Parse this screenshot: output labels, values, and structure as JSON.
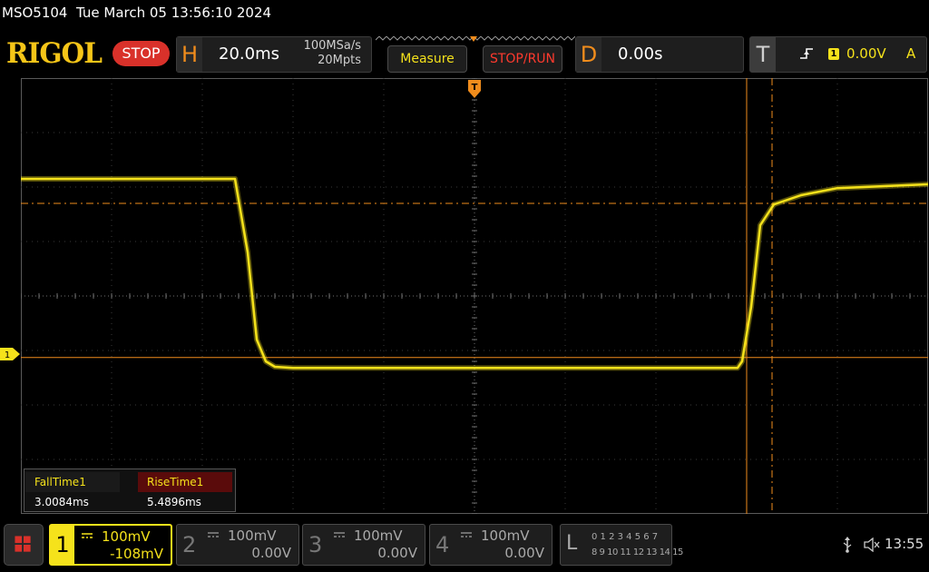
{
  "header": {
    "model": "MSO5104",
    "datetime": "Tue March 05 13:56:10 2024",
    "logo_text": "RIGOL",
    "run_state": "STOP"
  },
  "horizontal": {
    "label": "H",
    "timebase": "20.0ms",
    "sample_rate": "100MSa/s",
    "memory_depth": "20Mpts"
  },
  "buttons": {
    "measure": "Measure",
    "stop_run": "STOP/RUN"
  },
  "delay": {
    "label": "D",
    "value": "0.00s"
  },
  "trigger": {
    "label": "T",
    "source": "1",
    "level": "0.00V",
    "mode": "A",
    "edge_icon": "rising-edge-icon"
  },
  "measurements": {
    "headers": [
      "FallTime1",
      "RiseTime1"
    ],
    "values": [
      "3.0084ms",
      "5.4896ms"
    ]
  },
  "channels": [
    {
      "num": "1",
      "scale": "100mV",
      "offset": "-108mV",
      "active": true
    },
    {
      "num": "2",
      "scale": "100mV",
      "offset": "0.00V",
      "active": false
    },
    {
      "num": "3",
      "scale": "100mV",
      "offset": "0.00V",
      "active": false
    },
    {
      "num": "4",
      "scale": "100mV",
      "offset": "0.00V",
      "active": false
    }
  ],
  "logic": {
    "label": "L",
    "row1": "0 1 2 3  4 5 6 7",
    "row2": "8 9 10 11 12 13 14 15"
  },
  "status": {
    "clock": "13:55",
    "ch1_marker": "1"
  },
  "colors": {
    "ch1": "#f5e21b",
    "accent_orange": "#f08c1c",
    "stop_red": "#d9312a"
  },
  "chart_data": {
    "type": "line",
    "title": "",
    "xlabel": "",
    "ylabel": "",
    "grid": true,
    "divisions": {
      "x": 10,
      "y": 8
    },
    "units": {
      "x": "div",
      "y": "div"
    },
    "series": [
      {
        "x": [
          -5.0,
          -2.64,
          -2.5,
          -2.4,
          -2.3,
          -2.2,
          -2.0,
          2.9,
          2.95,
          3.05,
          3.15,
          3.3,
          3.6,
          4.0,
          5.0
        ],
        "y": [
          2.15,
          2.15,
          0.8,
          -0.8,
          -1.2,
          -1.3,
          -1.32,
          -1.32,
          -1.2,
          -0.2,
          1.3,
          1.68,
          1.85,
          1.98,
          2.05
        ]
      }
    ],
    "cursors": {
      "v1_div": 3.0,
      "v2_div": 3.28,
      "h1_div": 1.7,
      "h2_div": -1.13
    }
  }
}
